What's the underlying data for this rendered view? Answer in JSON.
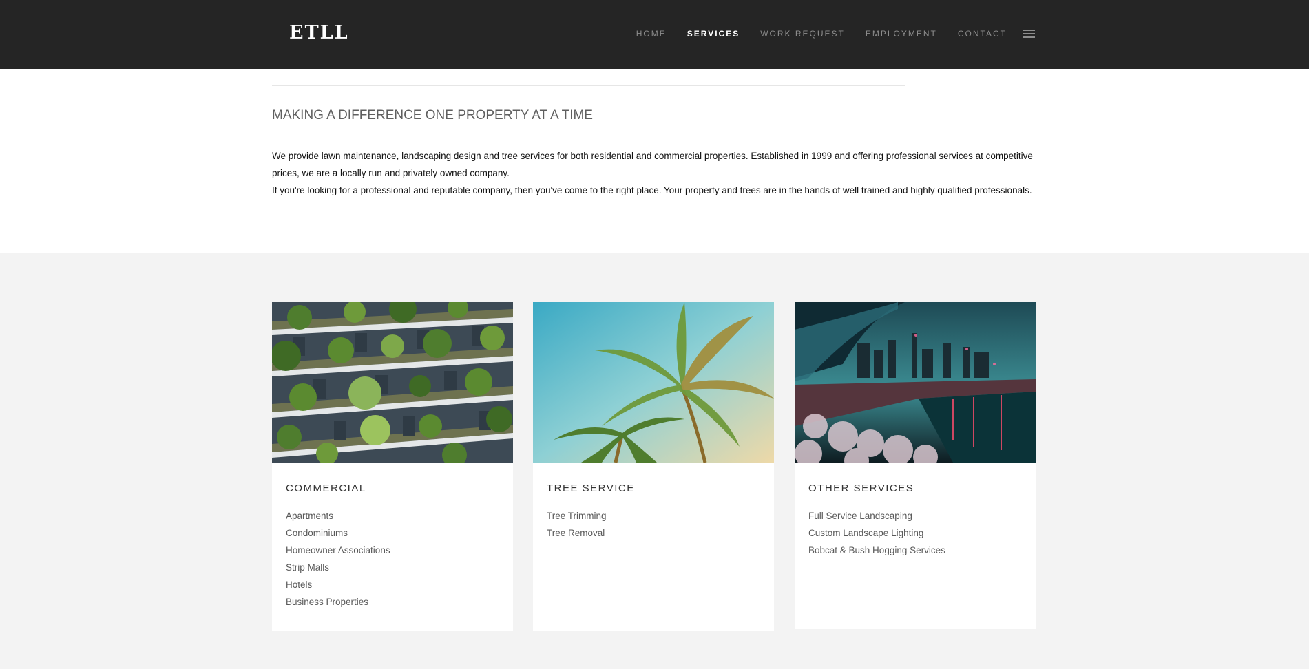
{
  "header": {
    "logo": "ETLL",
    "nav": [
      {
        "label": "HOME",
        "active": false
      },
      {
        "label": "SERVICES",
        "active": true
      },
      {
        "label": "WORK REQUEST",
        "active": false
      },
      {
        "label": "EMPLOYMENT",
        "active": false
      },
      {
        "label": "CONTACT",
        "active": false
      }
    ],
    "menu_icon": "hamburger-menu-icon"
  },
  "intro": {
    "title": "MAKING A DIFFERENCE ONE PROPERTY AT A TIME",
    "paragraph_1": "We provide lawn maintenance, landscaping design and tree services for both residential and commercial properties. Established in 1999 and offering professional services at competitive prices, we are a locally run and privately owned company.",
    "paragraph_2": "If you're looking for a professional and reputable company, then you've come to the right place. Your property and trees are in the hands of well trained and highly qualified professionals."
  },
  "cards": [
    {
      "title": "COMMERCIAL",
      "image": "building-balconies-image",
      "items": [
        "Apartments",
        "Condominiums",
        "Homeowner Associations",
        "Strip Malls",
        "Hotels",
        "Business Properties"
      ]
    },
    {
      "title": "TREE SERVICE",
      "image": "palm-trees-image",
      "items": [
        "Tree Trimming",
        "Tree Removal"
      ]
    },
    {
      "title": "OTHER SERVICES",
      "image": "city-canal-image",
      "items": [
        "Full Service Landscaping",
        "Custom Landscape Lighting",
        "Bobcat & Bush Hogging Services"
      ]
    }
  ],
  "colors": {
    "header_bg": "#252525",
    "nav_inactive": "#8d8d8d",
    "nav_active": "#ffffff",
    "page_bg": "#f3f3f3"
  }
}
